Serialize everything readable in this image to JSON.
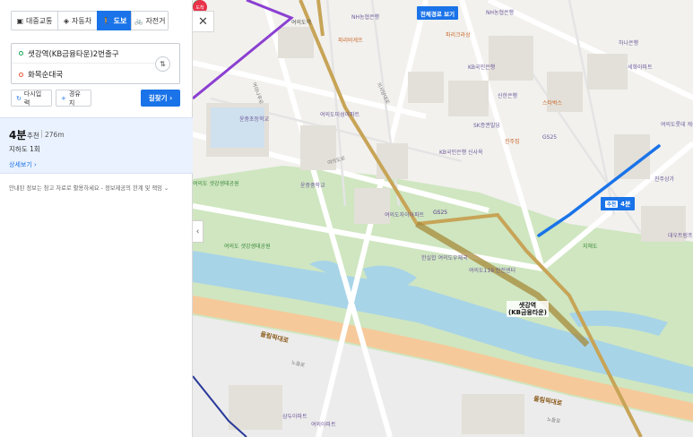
{
  "modes": [
    {
      "label": "대중교통",
      "icon": "bus-icon"
    },
    {
      "label": "자동차",
      "icon": "car-icon"
    },
    {
      "label": "도보",
      "icon": "walk-icon",
      "active": true
    },
    {
      "label": "자전거",
      "icon": "bicycle-icon"
    }
  ],
  "route": {
    "start": "샛강역(KB금융타운)2번출구",
    "end": "화목순대국"
  },
  "actions": {
    "reset": "다시입력",
    "waypoint": "경유지",
    "search": "길찾기"
  },
  "result": {
    "duration": "4분",
    "recommend": "추천",
    "distance": "276m",
    "crossing": "지하도 1회",
    "detail": "상세보기"
  },
  "notice": "안내된 정보는 참고 자료로 활용하세요 - 정보제공의 한계 및 책임",
  "map": {
    "full_route": "전체경로 보기",
    "badge_tag": "추천",
    "badge_time": "4분",
    "start_pin": "출발",
    "end_pin": "도착",
    "colors": {
      "route": "#1a73e8",
      "line9": "#c7a457",
      "line5": "#8b3fd1",
      "start": "#19a456",
      "end": "#e8334a"
    },
    "labels": [
      {
        "id": "station",
        "text": "샛강역\n(KB금융타운)"
      },
      {
        "id": "olympic1",
        "text": "올림픽대로"
      },
      {
        "id": "olympic2",
        "text": "올림픽대로"
      },
      {
        "id": "yeouido-park",
        "text": "여의도 샛강생태공원"
      },
      {
        "id": "yeouido-park2",
        "text": "여의도 샛강생태공원"
      },
      {
        "id": "jihae",
        "text": "지해도"
      },
      {
        "id": "yeoui-st",
        "text": "여의도역"
      },
      {
        "id": "nh1",
        "text": "NH농협은행"
      },
      {
        "id": "nh2",
        "text": "NH농협은행"
      },
      {
        "id": "kb",
        "text": "KB국민은행"
      },
      {
        "id": "shinhan",
        "text": "신한은행"
      },
      {
        "id": "gs25a",
        "text": "GS25"
      },
      {
        "id": "gs25b",
        "text": "GS25"
      },
      {
        "id": "hana",
        "text": "하나은행"
      },
      {
        "id": "starbucks",
        "text": "스타벅스"
      },
      {
        "id": "paris",
        "text": "파리바게뜨"
      },
      {
        "id": "paris2",
        "text": "파리크라상"
      },
      {
        "id": "kb-sinsa",
        "text": "KB국민은행 신사옥"
      },
      {
        "id": "sk",
        "text": "SK증권빌딩"
      },
      {
        "id": "jinju",
        "text": "진주집"
      },
      {
        "id": "gs25c",
        "text": "GS25"
      },
      {
        "id": "yeouido-sch",
        "text": "윤중초등학교"
      },
      {
        "id": "yunjung-mid",
        "text": "윤중중학교"
      },
      {
        "id": "ywd-apt",
        "text": "여의도미성아파트"
      },
      {
        "id": "yeoui-apt",
        "text": "여의도자이아파트"
      },
      {
        "id": "samsu",
        "text": "삼두아파트"
      },
      {
        "id": "yeoui-apt2",
        "text": "여의아파트"
      },
      {
        "id": "police",
        "text": "여의도119 안전센터"
      },
      {
        "id": "mail",
        "text": "한실합 여의도우체국"
      },
      {
        "id": "hwamok",
        "text": "여의도롯데 캐슬아이비"
      },
      {
        "id": "jinju2",
        "text": "진주상가"
      },
      {
        "id": "daewoo",
        "text": "대우트럼프 월드"
      },
      {
        "id": "sewon",
        "text": "세화아파트"
      },
      {
        "id": "yeouido-ro",
        "text": "여의도로"
      },
      {
        "id": "noeul",
        "text": "노들로"
      },
      {
        "id": "noeul2",
        "text": "노들로"
      },
      {
        "id": "yeouinaru",
        "text": "여의나루로"
      },
      {
        "id": "uijeong",
        "text": "의사당대로"
      }
    ]
  }
}
